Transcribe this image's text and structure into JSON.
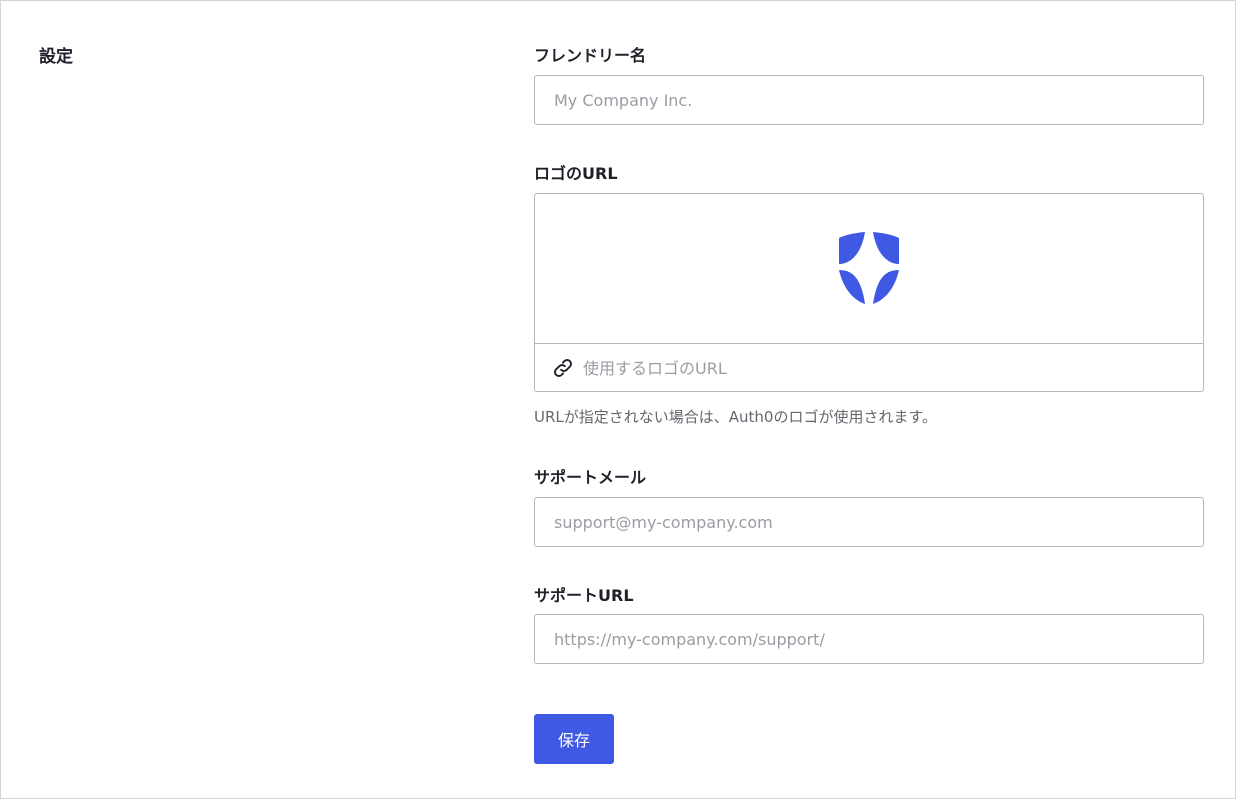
{
  "section": {
    "title": "設定"
  },
  "fields": {
    "friendly_name": {
      "label": "フレンドリー名",
      "placeholder": "My Company Inc."
    },
    "logo_url": {
      "label": "ロゴのURL",
      "placeholder": "使用するロゴのURL",
      "help": "URLが指定されない場合は、Auth0のロゴが使用されます。"
    },
    "support_email": {
      "label": "サポートメール",
      "placeholder": "support@my-company.com"
    },
    "support_url": {
      "label": "サポートURL",
      "placeholder": "https://my-company.com/support/"
    }
  },
  "actions": {
    "save_label": "保存"
  },
  "icons": {
    "logo": "shield-logo-icon",
    "link": "link-icon"
  },
  "colors": {
    "accent": "#3f59e4",
    "logo": "#3f59e4"
  }
}
